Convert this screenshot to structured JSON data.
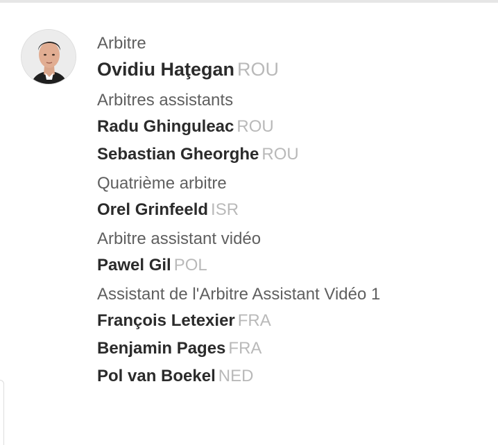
{
  "referee": {
    "role": "Arbitre",
    "name": "Ovidiu Haţegan",
    "country": "ROU"
  },
  "groups": [
    {
      "role": "Arbitres assistants",
      "people": [
        {
          "name": "Radu Ghinguleac",
          "country": "ROU"
        },
        {
          "name": "Sebastian Gheorghe",
          "country": "ROU"
        }
      ]
    },
    {
      "role": "Quatrième arbitre",
      "people": [
        {
          "name": "Orel Grinfeeld",
          "country": "ISR"
        }
      ]
    },
    {
      "role": "Arbitre assistant vidéo",
      "people": [
        {
          "name": "Pawel Gil",
          "country": "POL"
        }
      ]
    },
    {
      "role": "Assistant de l'Arbitre Assistant Vidéo 1",
      "people": [
        {
          "name": "François Letexier",
          "country": "FRA"
        },
        {
          "name": "Benjamin Pages",
          "country": "FRA"
        },
        {
          "name": "Pol van Boekel",
          "country": "NED"
        }
      ]
    }
  ]
}
